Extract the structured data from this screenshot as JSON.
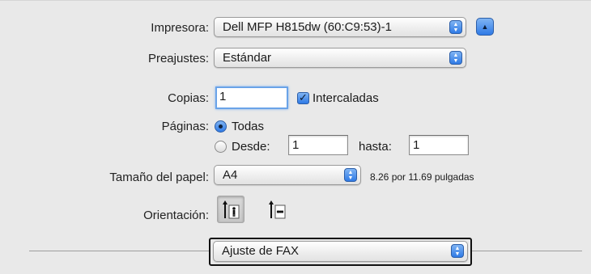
{
  "printer": {
    "label": "Impresora:",
    "value": "Dell MFP H815dw (60:C9:53)-1",
    "expand_icon": "disclosure-triangle-up"
  },
  "presets": {
    "label": "Preajustes:",
    "value": "Estándar"
  },
  "copies": {
    "label": "Copias:",
    "value": "1",
    "collate_label": "Intercaladas",
    "collate_checked": true
  },
  "pages": {
    "label": "Páginas:",
    "all_label": "Todas",
    "from_label": "Desde:",
    "from_value": "1",
    "to_label": "hasta:",
    "to_value": "1",
    "selected": "all"
  },
  "paper": {
    "label": "Tamaño del papel:",
    "value": "A4",
    "dimensions": "8.26 por 11.69 pulgadas"
  },
  "orientation": {
    "label": "Orientación:",
    "selected": "portrait"
  },
  "section": {
    "value": "Ajuste de FAX"
  },
  "colors": {
    "accent": "#2f7ae6",
    "background": "#e9e9e9"
  }
}
